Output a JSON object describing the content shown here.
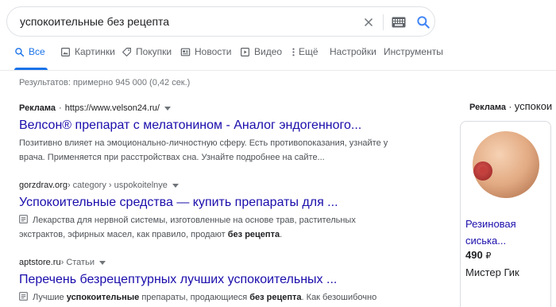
{
  "search": {
    "query": "успокоительные без рецепта"
  },
  "tabs": [
    {
      "label": "Все",
      "icon": "search-icon",
      "active": true
    },
    {
      "label": "Картинки",
      "icon": "image-icon"
    },
    {
      "label": "Покупки",
      "icon": "tag-icon"
    },
    {
      "label": "Новости",
      "icon": "news-icon"
    },
    {
      "label": "Видео",
      "icon": "play-icon"
    },
    {
      "label": "Ещё",
      "icon": "more-vert-icon"
    },
    {
      "label": "Настройки"
    },
    {
      "label": "Инструменты"
    }
  ],
  "stats": "Результатов: примерно 945 000 (0,42 сек.)",
  "results": [
    {
      "ad_label": "Реклама",
      "dot": "·",
      "url": "https://www.velson24.ru/",
      "title": "Велсон® препарат с мелатонином - Аналог эндогенного...",
      "snippet_line1": "Позитивно влияет на эмоционально-личностную сферу. Есть противопоказания, узнайте у",
      "snippet_line2": "врача. Применяется при расстройствах сна. Узнайте подробнее на сайте..."
    },
    {
      "domain": "gorzdrav.org",
      "path": " › category › uspokoitelnye",
      "title": "Успокоительные средства — купить препараты для ...",
      "snippet_line1": "Лекарства для нервной системы, изготовленные на основе трав, растительных",
      "snippet_line2_pre": "экстрактов, эфирных масел, как правило, продают ",
      "snippet_line2_bold": "без рецепта",
      "snippet_line2_post": "."
    },
    {
      "domain": "aptstore.ru",
      "path": " › Статьи",
      "title": "Перечень безрецептурных лучших успокоительных ...",
      "snippet_pre": "Лучшие ",
      "snippet_bold1": "успокоительные",
      "snippet_mid": " препараты, продающиеся ",
      "snippet_bold2": "без рецепта",
      "snippet_post": ". Как безошибочно"
    }
  ],
  "side_panel": {
    "ad_label": "Реклама",
    "dot": "·",
    "title": "успокои",
    "product": {
      "title_line1": "Резиновая",
      "title_line2": "сиська...",
      "price": "490",
      "currency": "₽",
      "seller": "Мистер Гик"
    }
  },
  "colors": {
    "link": "#1a0dab",
    "accent": "#1a73e8",
    "muted": "#70757a"
  }
}
